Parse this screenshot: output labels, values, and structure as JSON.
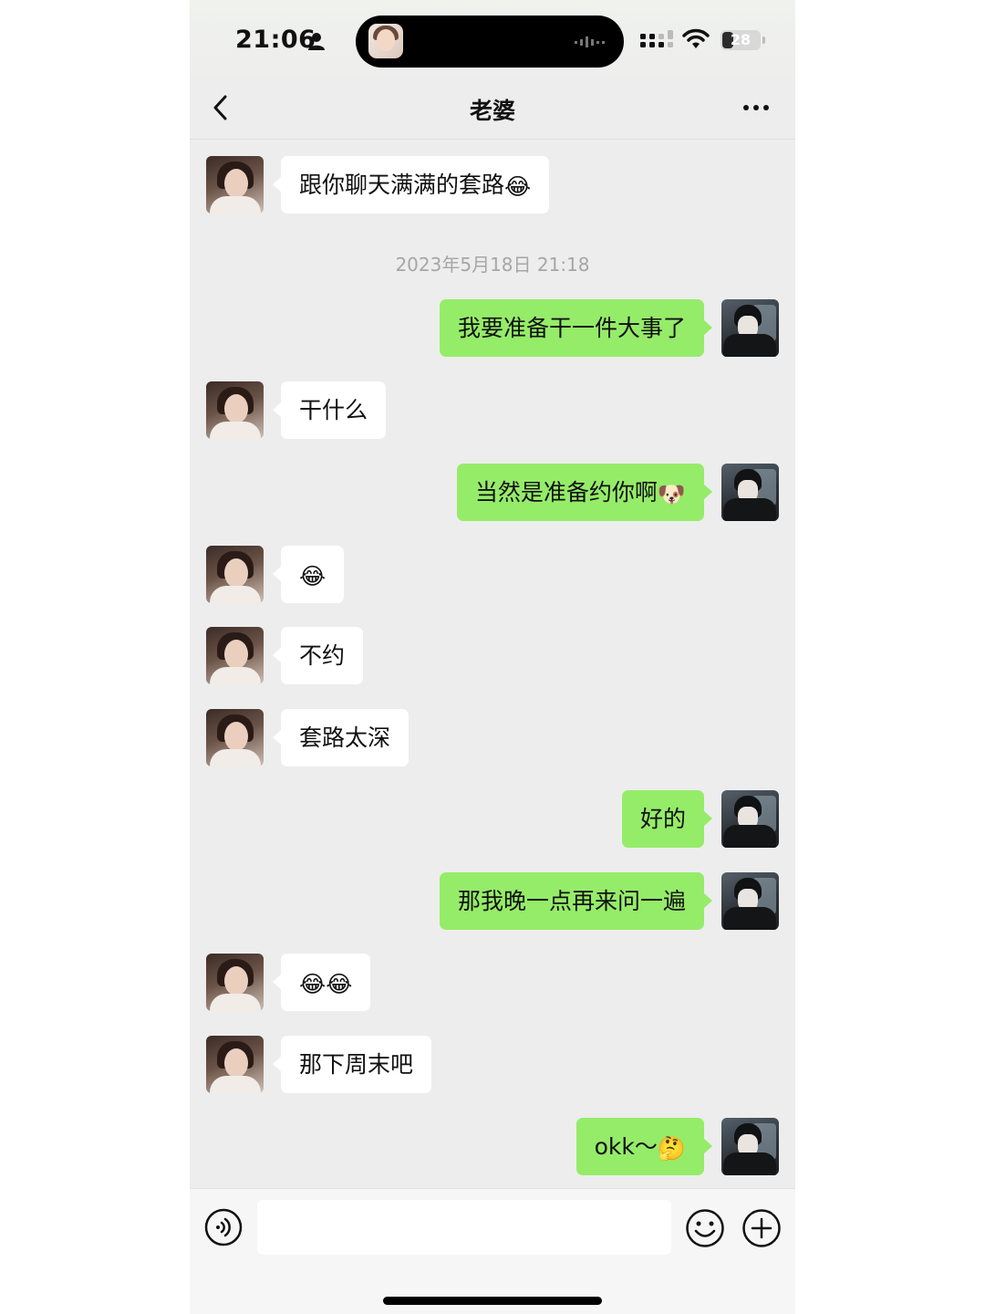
{
  "status_bar": {
    "time": "21:06",
    "battery": "28"
  },
  "header": {
    "title": "老婆"
  },
  "timestamp": "2023年5月18日 21:18",
  "messages": [
    {
      "from": "her",
      "text": "跟你聊天满满的套路",
      "emoji": "😂"
    },
    {
      "from": "me",
      "text": "我要准备干一件大事了",
      "emoji": ""
    },
    {
      "from": "her",
      "text": "干什么",
      "emoji": ""
    },
    {
      "from": "me",
      "text": "当然是准备约你啊",
      "emoji": "🐶"
    },
    {
      "from": "her",
      "text": "",
      "emoji": "😂"
    },
    {
      "from": "her",
      "text": "不约",
      "emoji": ""
    },
    {
      "from": "her",
      "text": "套路太深",
      "emoji": ""
    },
    {
      "from": "me",
      "text": "好的",
      "emoji": ""
    },
    {
      "from": "me",
      "text": "那我晚一点再来问一遍",
      "emoji": ""
    },
    {
      "from": "her",
      "text": "",
      "emoji": "😂😂"
    },
    {
      "from": "her",
      "text": "那下周末吧",
      "emoji": ""
    },
    {
      "from": "me",
      "text": "okk～",
      "emoji": "🤔"
    }
  ],
  "input": {
    "value": ""
  },
  "colors": {
    "sent_bubble": "#95ec69",
    "received_bubble": "#ffffff",
    "background": "#ededed"
  },
  "icons": {
    "back": "chevron-left-icon",
    "more": "more-dots-icon",
    "voice": "voice-icon",
    "emoji": "emoji-icon",
    "plus": "plus-icon",
    "wifi": "wifi-icon",
    "signal": "signal-icon",
    "person": "person-icon"
  }
}
